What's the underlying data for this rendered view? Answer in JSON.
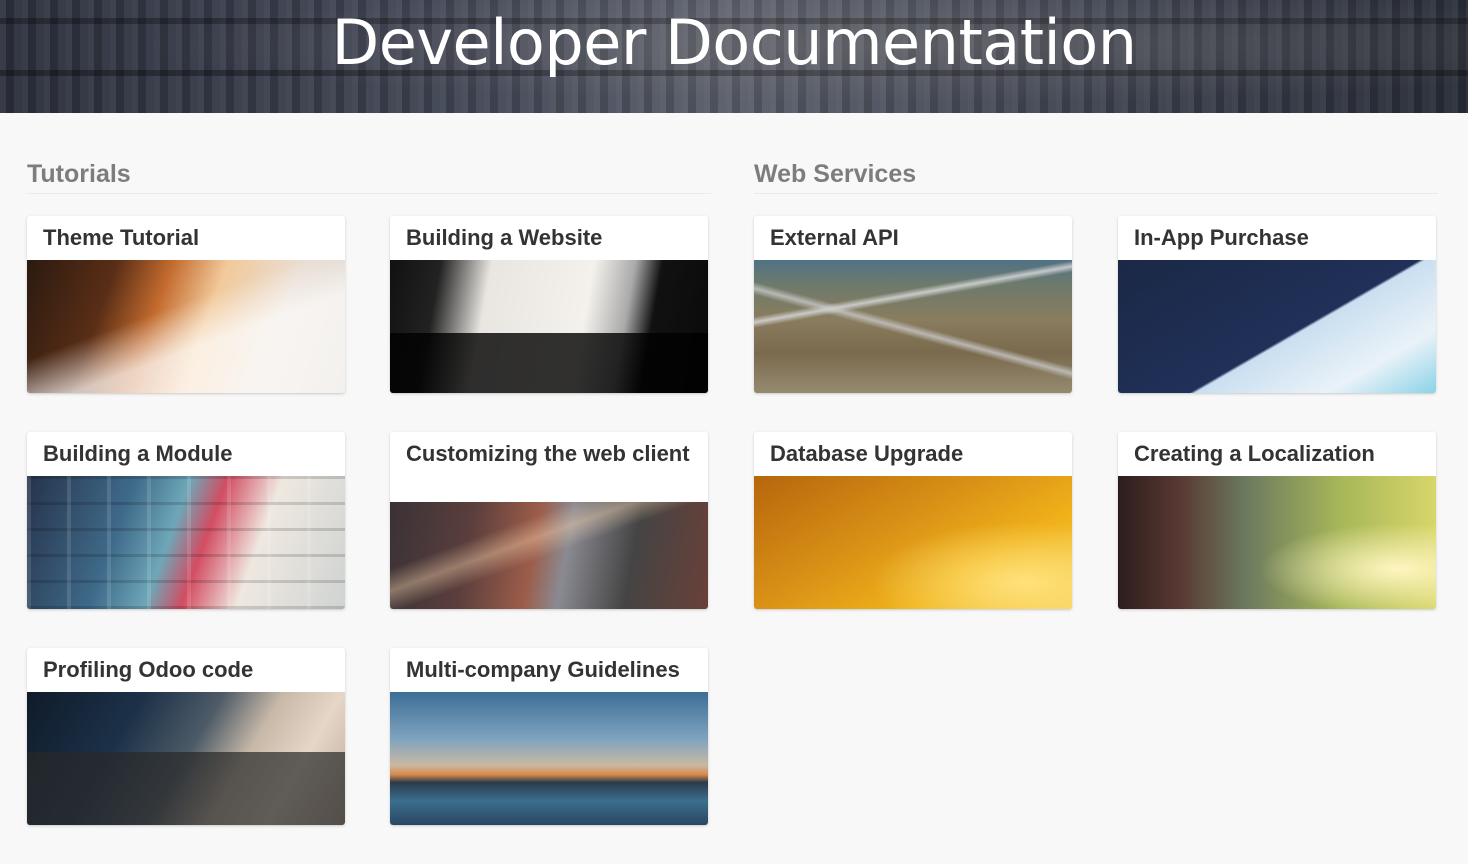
{
  "header": {
    "title": "Developer Documentation"
  },
  "sections": [
    {
      "title": "Tutorials",
      "cards": [
        {
          "title": "Theme Tutorial",
          "image": "laptop-drawing-tablet-photo"
        },
        {
          "title": "Building a Website",
          "image": "laptop-website-photo"
        },
        {
          "title": "Building a Module",
          "image": "building-facade-photo"
        },
        {
          "title": "Customizing the web client",
          "image": "highway-light-trails-photo"
        },
        {
          "title": "Profiling Odoo code",
          "image": "laptop-typing-photo"
        },
        {
          "title": "Multi-company Guidelines",
          "image": "city-skyline-photo"
        }
      ]
    },
    {
      "title": "Web Services",
      "cards": [
        {
          "title": "External API",
          "image": "highway-interchange-aerial-photo"
        },
        {
          "title": "In-App Purchase",
          "image": "analytics-dashboard-photo"
        },
        {
          "title": "Database Upgrade",
          "image": "birds-sunset-photo"
        },
        {
          "title": "Creating a Localization",
          "image": "globe-in-hand-photo"
        }
      ]
    }
  ]
}
